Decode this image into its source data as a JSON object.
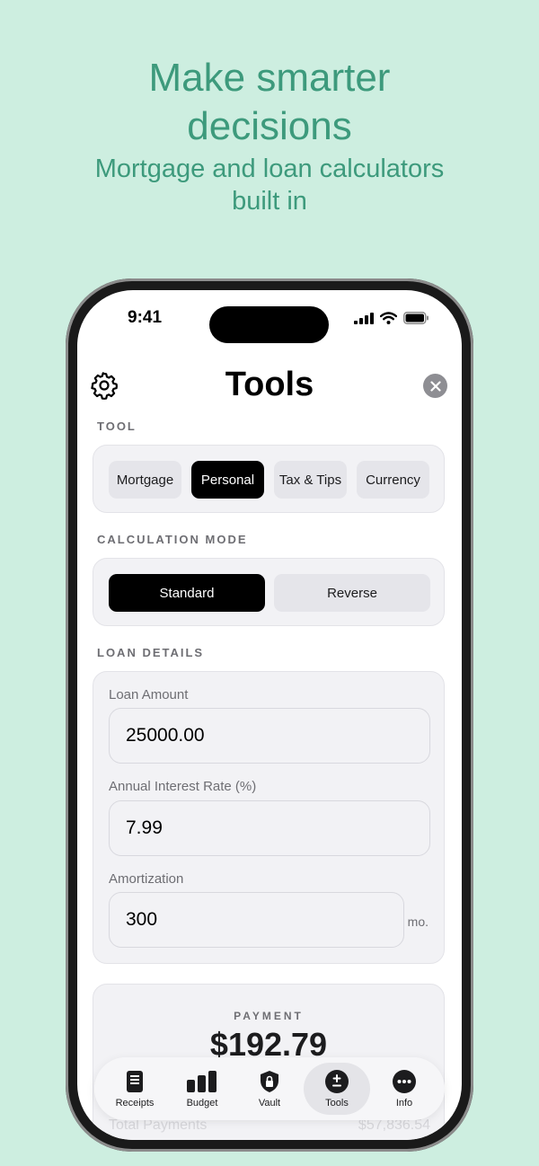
{
  "marketing": {
    "headline": "Make smarter decisions",
    "subheadline": "Mortgage and loan calculators built in"
  },
  "status_bar": {
    "time": "9:41"
  },
  "header": {
    "title": "Tools"
  },
  "tool_section": {
    "label": "TOOL",
    "options": [
      "Mortgage",
      "Personal",
      "Tax & Tips",
      "Currency"
    ],
    "selected": "Personal"
  },
  "mode_section": {
    "label": "CALCULATION MODE",
    "options": [
      "Standard",
      "Reverse"
    ],
    "selected": "Standard"
  },
  "loan_section": {
    "label": "LOAN DETAILS",
    "loan_amount_label": "Loan Amount",
    "loan_amount_value": "25000.00",
    "interest_label": "Annual Interest Rate (%)",
    "interest_value": "7.99",
    "amortization_label": "Amortization",
    "amortization_value": "300",
    "amortization_unit": "mo."
  },
  "result": {
    "label": "PAYMENT",
    "value": "$192.79",
    "total_payments_label": "Total Payments",
    "total_payments_value": "$57,836.54"
  },
  "tabbar": {
    "items": [
      {
        "label": "Receipts",
        "icon": "receipt-icon"
      },
      {
        "label": "Budget",
        "icon": "bar-chart-icon"
      },
      {
        "label": "Vault",
        "icon": "lock-shield-icon"
      },
      {
        "label": "Tools",
        "icon": "plus-minus-icon"
      },
      {
        "label": "Info",
        "icon": "more-icon"
      }
    ],
    "active": "Tools"
  },
  "colors": {
    "background": "#cdeee0",
    "marketing_text": "#3d9a7c",
    "active_segment": "#000000"
  }
}
